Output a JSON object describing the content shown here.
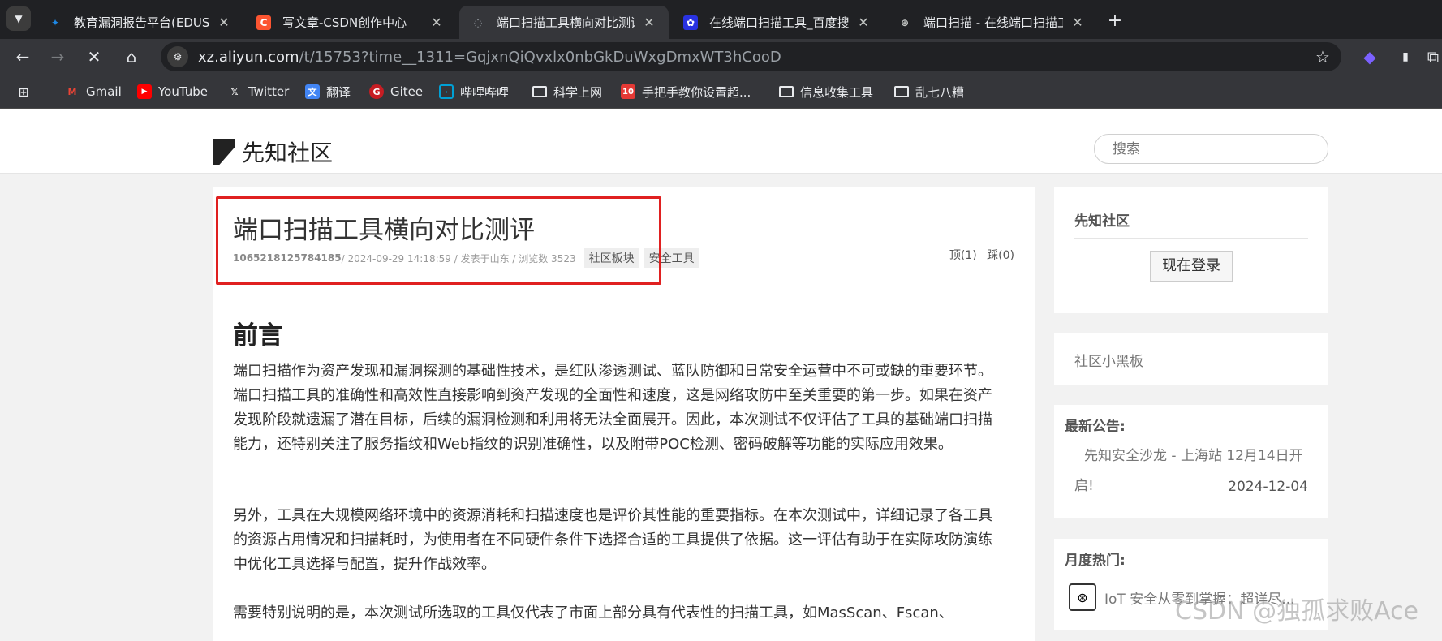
{
  "tabs": [
    {
      "title": "教育漏洞报告平台(EDUSRC)",
      "icon": "bird-icon",
      "color": "#1e88e5"
    },
    {
      "title": "写文章-CSDN创作中心",
      "icon": "csdn-icon",
      "color": "#fc5531"
    },
    {
      "title": "端口扫描工具横向对比测评 - 先知社区",
      "icon": "loading-icon",
      "color": "#9aa0a6"
    },
    {
      "title": "在线端口扫描工具_百度搜索",
      "icon": "baidu-icon",
      "color": "#2932e1"
    },
    {
      "title": "端口扫描 - 在线端口扫描工具",
      "icon": "globe-icon",
      "color": "#9aa0a6"
    }
  ],
  "address": {
    "host": "xz.aliyun.com",
    "path": "/t/15753?time__1311=GqjxnQiQvxlx0nbGkDuWxgDmxWT3hCooD"
  },
  "bookmarks": [
    {
      "label": "Gmail",
      "icon": "gmail-icon"
    },
    {
      "label": "YouTube",
      "icon": "youtube-icon"
    },
    {
      "label": "Twitter",
      "icon": "x-icon"
    },
    {
      "label": "翻译",
      "icon": "translate-icon"
    },
    {
      "label": "Gitee",
      "icon": "gitee-icon"
    },
    {
      "label": "哔哩哔哩",
      "icon": "bilibili-icon"
    },
    {
      "label": "科学上网",
      "icon": "folder-icon"
    },
    {
      "label": "手把手教你设置超...",
      "icon": "10-icon"
    },
    {
      "label": "信息收集工具",
      "icon": "folder-icon"
    },
    {
      "label": "乱七八糟",
      "icon": "folder-icon"
    }
  ],
  "site": {
    "name": "先知社区",
    "search_placeholder": "搜索"
  },
  "article": {
    "title": "端口扫描工具横向对比测评",
    "author": "1065218125784185",
    "meta": " / 2024-09-29 14:18:59 / 发表于山东 / 浏览数 3523",
    "tags": [
      "社区板块",
      "安全工具"
    ],
    "up": "顶(1)",
    "down": "踩(0)",
    "heading": "前言",
    "p1": "端口扫描作为资产发现和漏洞探测的基础性技术，是红队渗透测试、蓝队防御和日常安全运营中不可或缺的重要环节。端口扫描工具的准确性和高效性直接影响到资产发现的全面性和速度，这是网络攻防中至关重要的第一步。如果在资产发现阶段就遗漏了潜在目标，后续的漏洞检测和利用将无法全面展开。因此，本次测试不仅评估了工具的基础端口扫描能力，还特别关注了服务指纹和Web指纹的识别准确性，以及附带POC检测、密码破解等功能的实际应用效果。",
    "p2": "另外，工具在大规模网络环境中的资源消耗和扫描速度也是评价其性能的重要指标。在本次测试中，详细记录了各工具的资源占用情况和扫描耗时，为使用者在不同硬件条件下选择合适的工具提供了依据。这一评估有助于在实际攻防演练中优化工具选择与配置，提升作战效率。",
    "p3": "需要特别说明的是，本次测试所选取的工具仅代表了市面上部分具有代表性的扫描工具，如MasScan、Fscan、"
  },
  "sidebar": {
    "community_title": "先知社区",
    "login": "现在登录",
    "blackboard": "社区小黑板",
    "notice_title": "最新公告:",
    "notice_text": "先知安全沙龙 - 上海站 12月14日开启!",
    "notice_date": "2024-12-04",
    "hot_title": "月度热门:",
    "hot_item": "IoT 安全从零到掌握：超详尽..."
  },
  "watermark": "CSDN @独孤求败Ace"
}
